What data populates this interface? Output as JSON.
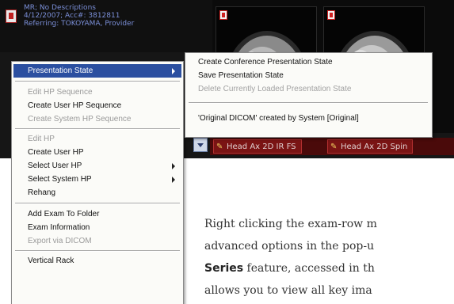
{
  "exam": {
    "line1": "MR; No Descriptions",
    "line2": "4/12/2007; Acc#: 3812811",
    "line3": "Referring: TOKOYAMA, Provider"
  },
  "series_tabs": [
    "Head Ax 2D IR FS",
    "Head Ax 2D Spin"
  ],
  "context_menu": {
    "items": [
      {
        "label": "Presentation State",
        "state": "selected",
        "submenu": true
      },
      {
        "label": "Edit HP Sequence",
        "state": "disabled"
      },
      {
        "label": "Create User HP Sequence",
        "state": "enabled"
      },
      {
        "label": "Create System HP Sequence",
        "state": "disabled"
      },
      {
        "label": "Edit HP",
        "state": "disabled"
      },
      {
        "label": "Create User HP",
        "state": "enabled"
      },
      {
        "label": "Select User HP",
        "state": "enabled",
        "submenu": true
      },
      {
        "label": "Select System HP",
        "state": "enabled",
        "submenu": true
      },
      {
        "label": "Rehang",
        "state": "enabled"
      },
      {
        "label": "Add Exam To Folder",
        "state": "enabled"
      },
      {
        "label": "Exam Information",
        "state": "enabled"
      },
      {
        "label": "Export via DICOM",
        "state": "disabled"
      },
      {
        "label": "Vertical Rack",
        "state": "enabled"
      }
    ]
  },
  "submenu": {
    "items": [
      {
        "label": "Create Conference Presentation State",
        "state": "enabled"
      },
      {
        "label": "Save Presentation State",
        "state": "enabled"
      },
      {
        "label": "Delete Currently Loaded Presentation State",
        "state": "disabled"
      },
      {
        "label": "'Original DICOM' created by System [Original]",
        "state": "enabled"
      }
    ]
  },
  "body_text": {
    "line1": "Right clicking the exam-row m",
    "line2": "advanced options in the pop-u",
    "line3_bold": "Series",
    "line3_rest": " feature, accessed in th",
    "line4": "allows you to view all key ima"
  },
  "colors": {
    "menu_highlight": "#2b4fa0",
    "viewer_background": "#161616",
    "series_bar": "#7a1414",
    "exam_text": "#7b8fd8"
  }
}
